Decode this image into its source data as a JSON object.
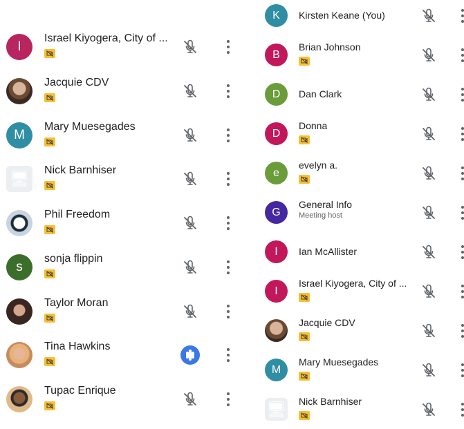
{
  "left_participants": [
    {
      "name": "Israel Kiyogera, City of ...",
      "initial": "I",
      "avatar_color": "#b8255f",
      "avatar_kind": "initial",
      "camera_off": true,
      "status": "muted"
    },
    {
      "name": "Jacquie CDV",
      "initial": "",
      "avatar_color": "",
      "avatar_kind": "photo-jacquie",
      "camera_off": true,
      "status": "muted"
    },
    {
      "name": "Mary Muesegades",
      "initial": "M",
      "avatar_color": "#2f8ea3",
      "avatar_kind": "initial",
      "camera_off": true,
      "status": "muted"
    },
    {
      "name": "Nick Barnhiser",
      "initial": "",
      "avatar_color": "",
      "avatar_kind": "photo-nick",
      "camera_off": true,
      "status": "muted"
    },
    {
      "name": "Phil Freedom",
      "initial": "",
      "avatar_color": "",
      "avatar_kind": "photo-phil",
      "camera_off": true,
      "status": "muted"
    },
    {
      "name": "sonja flippin",
      "initial": "s",
      "avatar_color": "#3c6e2b",
      "avatar_kind": "initial",
      "camera_off": true,
      "status": "muted"
    },
    {
      "name": "Taylor Moran",
      "initial": "",
      "avatar_color": "",
      "avatar_kind": "photo-taylor",
      "camera_off": true,
      "status": "muted"
    },
    {
      "name": "Tina Hawkins",
      "initial": "",
      "avatar_color": "",
      "avatar_kind": "photo-tina",
      "camera_off": true,
      "status": "speaking"
    },
    {
      "name": "Tupac Enrique",
      "initial": "",
      "avatar_color": "",
      "avatar_kind": "photo-tupac",
      "camera_off": true,
      "status": "muted"
    }
  ],
  "right_participants": [
    {
      "name": "Kirsten Keane (You)",
      "sub": "",
      "initial": "K",
      "avatar_color": "#2f8ea3",
      "avatar_kind": "initial",
      "camera_off": false,
      "status": "muted"
    },
    {
      "name": "Brian Johnson",
      "sub": "",
      "initial": "B",
      "avatar_color": "#c2185b",
      "avatar_kind": "initial",
      "camera_off": true,
      "status": "muted"
    },
    {
      "name": "Dan Clark",
      "sub": "",
      "initial": "D",
      "avatar_color": "#6a9c3a",
      "avatar_kind": "initial",
      "camera_off": false,
      "status": "muted"
    },
    {
      "name": "Donna",
      "sub": "",
      "initial": "D",
      "avatar_color": "#c2185b",
      "avatar_kind": "initial",
      "camera_off": true,
      "status": "muted"
    },
    {
      "name": "evelyn a.",
      "sub": "",
      "initial": "e",
      "avatar_color": "#6a9c3a",
      "avatar_kind": "initial",
      "camera_off": true,
      "status": "muted"
    },
    {
      "name": "General Info",
      "sub": "Meeting host",
      "initial": "G",
      "avatar_color": "#4527a0",
      "avatar_kind": "initial",
      "camera_off": false,
      "status": "muted"
    },
    {
      "name": "Ian McAllister",
      "sub": "",
      "initial": "I",
      "avatar_color": "#c2185b",
      "avatar_kind": "initial",
      "camera_off": false,
      "status": "muted"
    },
    {
      "name": "Israel Kiyogera, City of ...",
      "sub": "",
      "initial": "I",
      "avatar_color": "#c2185b",
      "avatar_kind": "initial",
      "camera_off": true,
      "status": "muted"
    },
    {
      "name": "Jacquie CDV",
      "sub": "",
      "initial": "",
      "avatar_color": "",
      "avatar_kind": "photo-jacquie",
      "camera_off": true,
      "status": "muted"
    },
    {
      "name": "Mary Muesegades",
      "sub": "",
      "initial": "M",
      "avatar_color": "#2f8ea3",
      "avatar_kind": "initial",
      "camera_off": true,
      "status": "muted"
    },
    {
      "name": "Nick Barnhiser",
      "sub": "",
      "initial": "",
      "avatar_color": "",
      "avatar_kind": "photo-nick",
      "camera_off": true,
      "status": "muted"
    }
  ],
  "icons": {
    "mic_off": "mic-off-icon",
    "speaking": "audio-level-icon",
    "more": "more-vert-icon",
    "camera_off": "videocam-off-icon"
  },
  "colors": {
    "camera_badge": "#f9bf32",
    "icon_gray": "#5f6368",
    "speaking_blue": "#3b78e7"
  }
}
